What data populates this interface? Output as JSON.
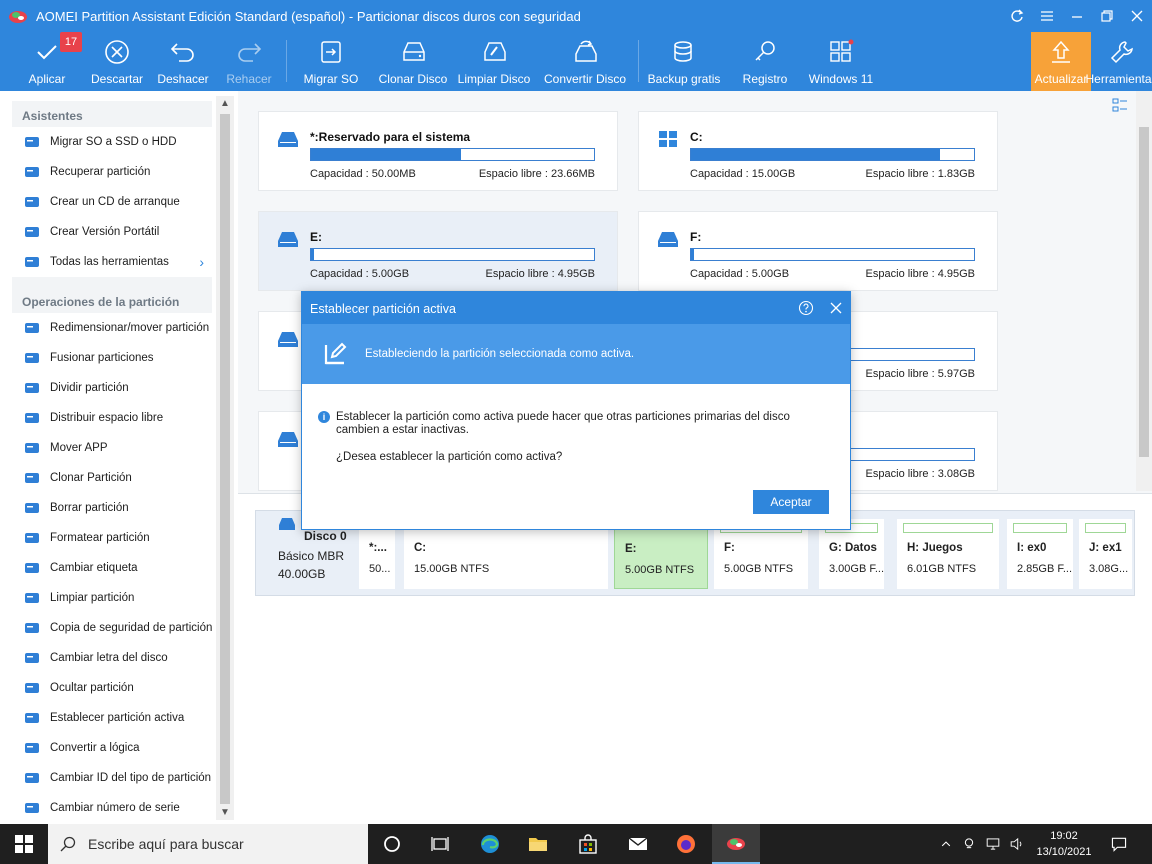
{
  "window": {
    "title": "AOMEI Partition Assistant Edición Standard (español) - Particionar discos duros con seguridad"
  },
  "toolbar": {
    "apply": "Aplicar",
    "apply_badge": "17",
    "discard": "Descartar",
    "undo": "Deshacer",
    "redo": "Rehacer",
    "migrate_os": "Migrar SO",
    "clone_disk": "Clonar Disco",
    "wipe_disk": "Limpiar Disco",
    "convert_disk": "Convertir Disco",
    "backup": "Backup gratis",
    "register": "Registro",
    "windows11": "Windows 11",
    "update": "Actualizar",
    "tools": "Herramientas"
  },
  "sidebar": {
    "wizards_title": "Asistentes",
    "wizards": [
      {
        "label": "Migrar SO a SSD o HDD",
        "icon": "migrate-os-icon"
      },
      {
        "label": "Recuperar partición",
        "icon": "recover-partition-icon"
      },
      {
        "label": "Crear un CD de arranque",
        "icon": "bootable-cd-icon"
      },
      {
        "label": "Crear Versión Portátil",
        "icon": "portable-version-icon"
      },
      {
        "label": "Todas las herramientas",
        "icon": "all-tools-icon"
      }
    ],
    "ops_title": "Operaciones de la partición",
    "ops": [
      {
        "label": "Redimensionar/mover partición",
        "icon": "resize-icon"
      },
      {
        "label": "Fusionar particiones",
        "icon": "merge-icon"
      },
      {
        "label": "Dividir partición",
        "icon": "split-icon"
      },
      {
        "label": "Distribuir espacio libre",
        "icon": "allocate-icon"
      },
      {
        "label": "Mover APP",
        "icon": "move-app-icon"
      },
      {
        "label": "Clonar Partición",
        "icon": "clone-partition-icon"
      },
      {
        "label": "Borrar partición",
        "icon": "delete-partition-icon"
      },
      {
        "label": "Formatear partición",
        "icon": "format-icon"
      },
      {
        "label": "Cambiar etiqueta",
        "icon": "label-icon"
      },
      {
        "label": "Limpiar partición",
        "icon": "wipe-partition-icon"
      },
      {
        "label": "Copia de seguridad de partición",
        "icon": "backup-partition-icon"
      },
      {
        "label": "Cambiar letra del disco",
        "icon": "drive-letter-icon"
      },
      {
        "label": "Ocultar partición",
        "icon": "hide-partition-icon"
      },
      {
        "label": "Establecer partición activa",
        "icon": "set-active-icon"
      },
      {
        "label": "Convertir a lógica",
        "icon": "convert-logical-icon"
      },
      {
        "label": "Cambiar ID del tipo de partición",
        "icon": "partition-id-icon"
      },
      {
        "label": "Cambiar número de serie",
        "icon": "serial-number-icon"
      }
    ]
  },
  "cards": [
    {
      "name": "*:Reservado para el sistema",
      "capacity": "Capacidad : 50.00MB",
      "free": "Espacio libre : 23.66MB",
      "used": 0.53
    },
    {
      "name": "C:",
      "capacity": "Capacidad : 15.00GB",
      "free": "Espacio libre : 1.83GB",
      "used": 0.88
    },
    {
      "name": "E:",
      "capacity": "Capacidad : 5.00GB",
      "free": "Espacio libre : 4.95GB",
      "used": 0.01
    },
    {
      "name": "F:",
      "capacity": "Capacidad : 5.00GB",
      "free": "Espacio libre : 4.95GB",
      "used": 0.01
    },
    {
      "free": "Espacio libre : 5.97GB",
      "used": 0.01
    },
    {
      "free": "Espacio libre : 3.08GB",
      "used": 0.01
    }
  ],
  "disk": {
    "name": "Disco 0",
    "type": "Básico MBR",
    "size": "40.00GB",
    "partitions": [
      {
        "name": "*:...",
        "info": "50..."
      },
      {
        "name": "C:",
        "info": "15.00GB NTFS"
      },
      {
        "name": "E:",
        "info": "5.00GB NTFS"
      },
      {
        "name": "F:",
        "info": "5.00GB NTFS"
      },
      {
        "name": "G: Datos",
        "info": "3.00GB F..."
      },
      {
        "name": "H: Juegos",
        "info": "6.01GB NTFS"
      },
      {
        "name": "I: ex0",
        "info": "2.85GB F..."
      },
      {
        "name": "J: ex1",
        "info": "3.08G..."
      }
    ]
  },
  "dialog": {
    "title": "Establecer partición activa",
    "header": "Estableciendo la partición seleccionada como activa.",
    "message": "Establecer la partición como activa puede hacer que otras particiones primarias del disco cambien a estar inactivas.",
    "question": "¿Desea establecer la partición como activa?",
    "ok": "Aceptar"
  },
  "taskbar": {
    "search_placeholder": "Escribe aquí para buscar",
    "time": "19:02",
    "date": "13/10/2021"
  },
  "colors": {
    "brand": "#2f86dc",
    "accent_orange": "#f7a239",
    "selected_green": "#c9eec3"
  }
}
